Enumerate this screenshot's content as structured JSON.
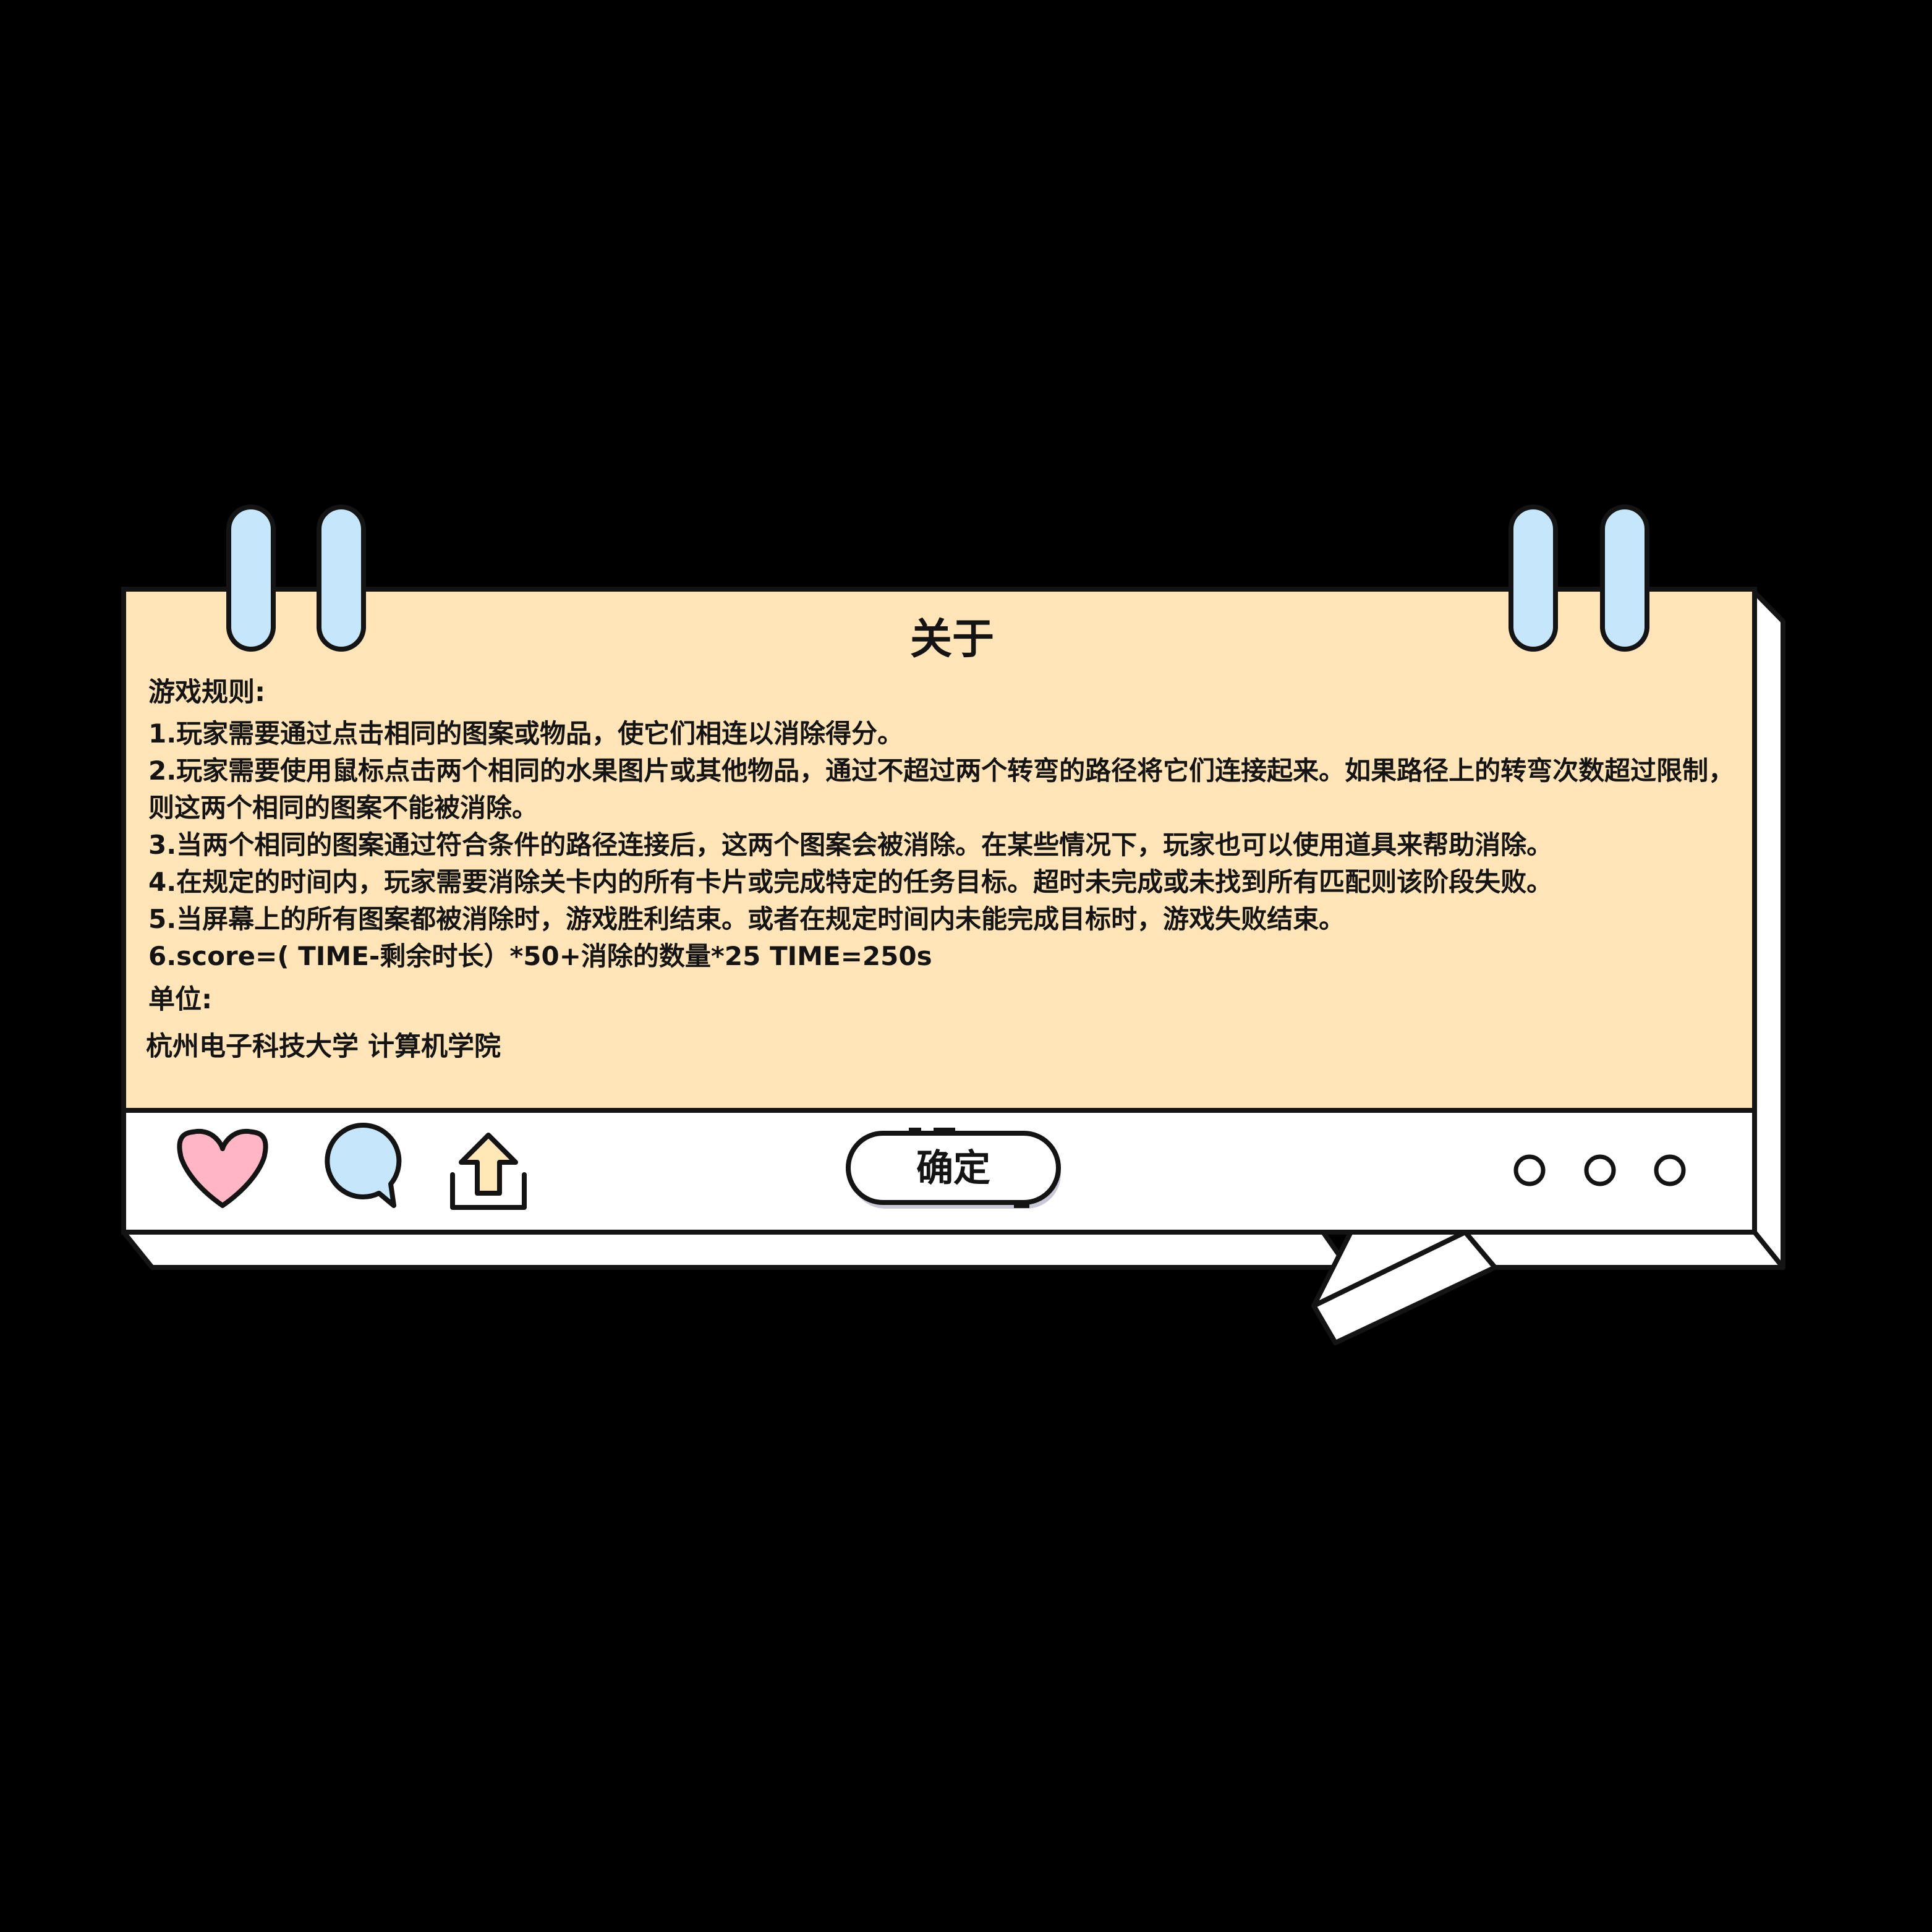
{
  "dialog": {
    "title": "关于",
    "rules_heading": "游戏规则:",
    "rules": [
      "1.玩家需要通过点击相同的图案或物品，使它们相连以消除得分。",
      "2.玩家需要使用鼠标点击两个相同的水果图片或其他物品，通过不超过两个转弯的路径将它们连接起来。如果路径上的转弯次数超过限制，则这两个相同的图案不能被消除。",
      "3.当两个相同的图案通过符合条件的路径连接后，这两个图案会被消除。在某些情况下，玩家也可以使用道具来帮助消除。",
      "4.在规定的时间内，玩家需要消除关卡内的所有卡片或完成特定的任务目标。超时未完成或未找到所有匹配则该阶段失败。",
      "5.当屏幕上的所有图案都被消除时，游戏胜利结束。或者在规定时间内未能完成目标时，游戏失败结束。",
      "6.score=(  TIME-剩余时长）*50+消除的数量*25    TIME=250s"
    ],
    "unit_heading": "单位:",
    "unit_value": "杭州电子科技大学  计算机学院"
  },
  "toolbar": {
    "confirm_label": "确定",
    "icons": [
      "heart-icon",
      "comment-bubble-icon",
      "share-upload-icon",
      "more-dots-icon"
    ]
  },
  "colors": {
    "background": "#000000",
    "panel": "#FEE4B6",
    "toolbar": "#FFFFFF",
    "outline": "#141414",
    "clip": "#C5E6FB",
    "heart": "#FFB5C3",
    "bubble": "#C5E6FB",
    "share": "#FFE7B6"
  }
}
